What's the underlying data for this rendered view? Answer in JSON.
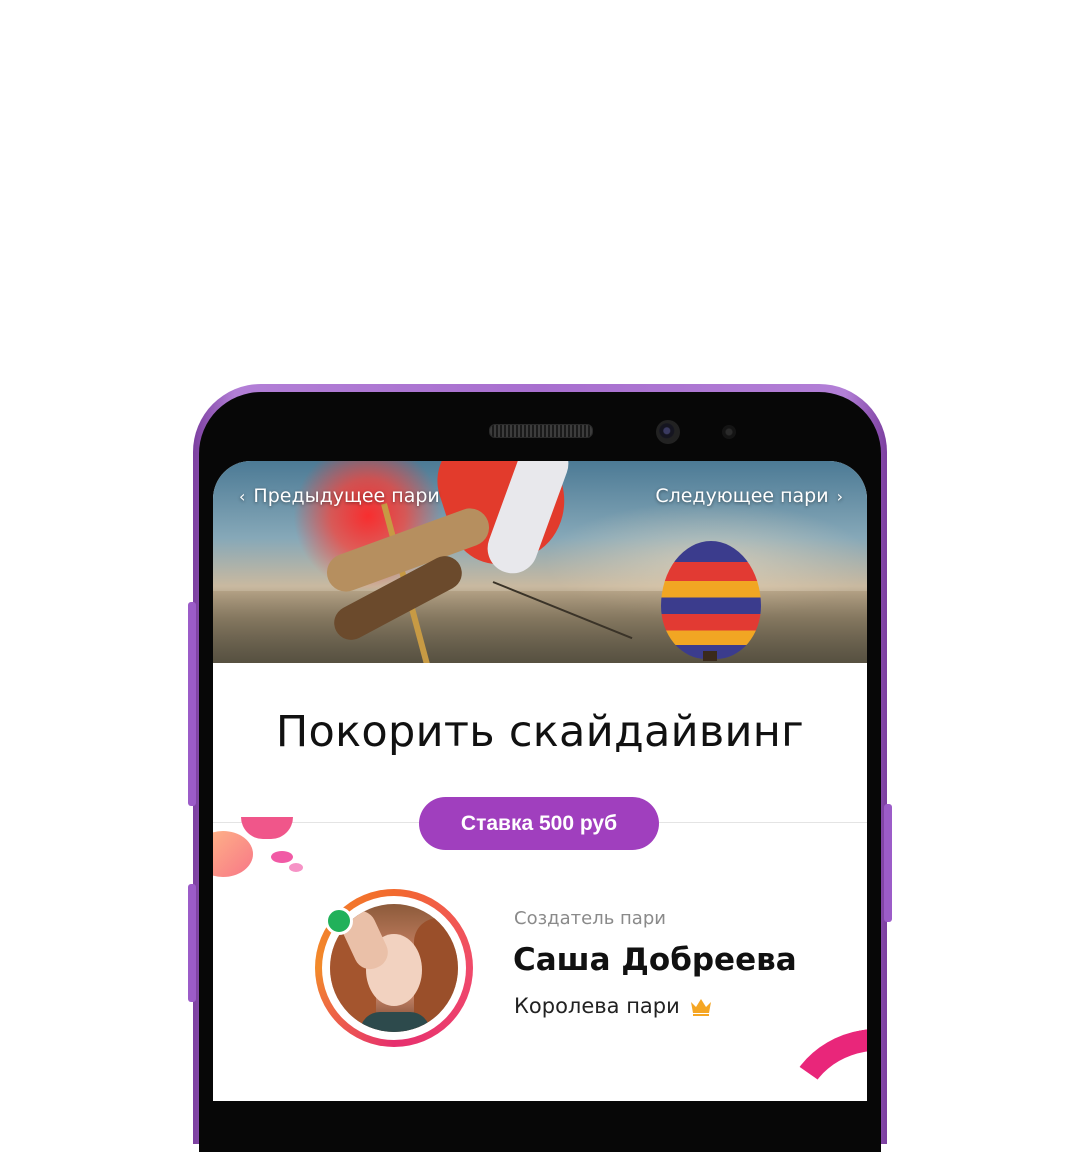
{
  "navigation": {
    "prev_label": "Предыдущее пари",
    "next_label": "Следующее пари",
    "prev_icon": "chevron-left-icon",
    "next_icon": "chevron-right-icon"
  },
  "bet": {
    "title": "Покорить скайдайвинг",
    "stake_label": "Ставка 500 руб"
  },
  "creator": {
    "caption": "Создатель пари",
    "name": "Саша Добреева",
    "status": "Королева пари",
    "status_icon": "crown-icon",
    "online": true
  },
  "colors": {
    "accent": "#a03fbe",
    "online": "#21b15a",
    "crown": "#f5a623",
    "phone_frame": "#a86fcf"
  }
}
